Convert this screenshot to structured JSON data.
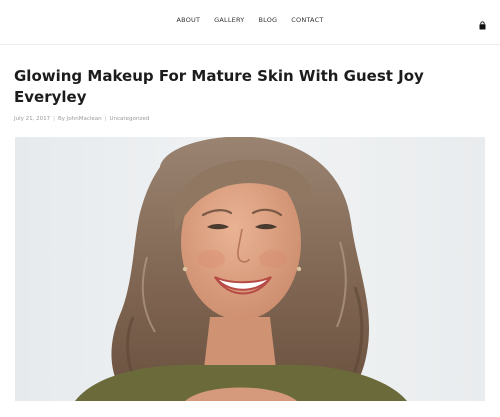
{
  "nav": {
    "items": [
      {
        "label": "ABOUT"
      },
      {
        "label": "GALLERY"
      },
      {
        "label": "BLOG"
      },
      {
        "label": "CONTACT"
      }
    ],
    "cart_icon": "shopping-bag-icon"
  },
  "post": {
    "title": "Glowing Makeup For Mature Skin With Guest Joy Everyley",
    "date": "July 21, 2017",
    "author": "By JohnMaclean",
    "category": "Uncategorized",
    "separator": "|"
  },
  "hero": {
    "background_color": "#eef1f3",
    "hair_color": "#8a7058",
    "skin_color": "#e0a585",
    "top_color": "#6b6a3a"
  }
}
